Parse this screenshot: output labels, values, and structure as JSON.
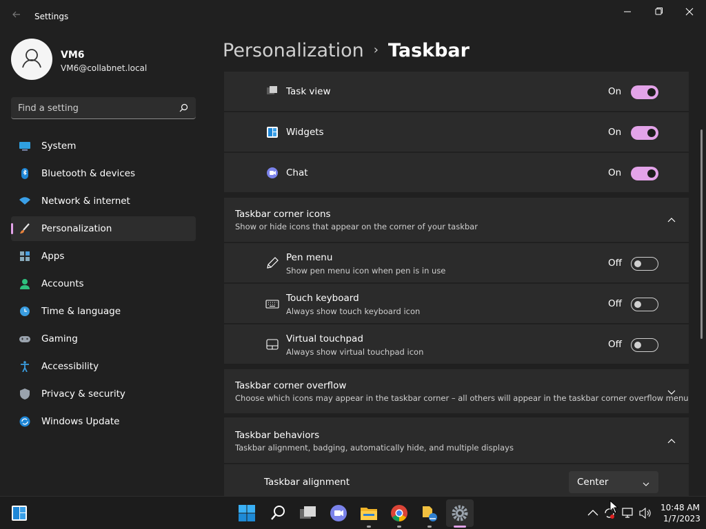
{
  "app": {
    "title": "Settings"
  },
  "user": {
    "name": "VM6",
    "email": "VM6@collabnet.local"
  },
  "search": {
    "placeholder": "Find a setting"
  },
  "sidebar": {
    "items": [
      {
        "label": "System",
        "icon": "monitor-icon"
      },
      {
        "label": "Bluetooth & devices",
        "icon": "bluetooth-icon"
      },
      {
        "label": "Network & internet",
        "icon": "wifi-icon"
      },
      {
        "label": "Personalization",
        "icon": "brush-icon",
        "active": true
      },
      {
        "label": "Apps",
        "icon": "apps-icon"
      },
      {
        "label": "Accounts",
        "icon": "person-icon"
      },
      {
        "label": "Time & language",
        "icon": "clock-globe-icon"
      },
      {
        "label": "Gaming",
        "icon": "gamepad-icon"
      },
      {
        "label": "Accessibility",
        "icon": "accessibility-icon"
      },
      {
        "label": "Privacy & security",
        "icon": "shield-icon"
      },
      {
        "label": "Windows Update",
        "icon": "update-icon"
      }
    ]
  },
  "breadcrumb": {
    "parent": "Personalization",
    "separator": "›",
    "current": "Taskbar"
  },
  "taskbar_items": [
    {
      "label": "Task view",
      "state": "On",
      "on": true
    },
    {
      "label": "Widgets",
      "state": "On",
      "on": true
    },
    {
      "label": "Chat",
      "state": "On",
      "on": true
    }
  ],
  "corner_icons": {
    "title": "Taskbar corner icons",
    "desc": "Show or hide icons that appear on the corner of your taskbar",
    "items": [
      {
        "label": "Pen menu",
        "desc": "Show pen menu icon when pen is in use",
        "state": "Off",
        "on": false
      },
      {
        "label": "Touch keyboard",
        "desc": "Always show touch keyboard icon",
        "state": "Off",
        "on": false
      },
      {
        "label": "Virtual touchpad",
        "desc": "Always show virtual touchpad icon",
        "state": "Off",
        "on": false
      }
    ]
  },
  "corner_overflow": {
    "title": "Taskbar corner overflow",
    "desc": "Choose which icons may appear in the taskbar corner – all others will appear in the taskbar corner overflow menu"
  },
  "behaviors": {
    "title": "Taskbar behaviors",
    "desc": "Taskbar alignment, badging, automatically hide, and multiple displays",
    "alignment_label": "Taskbar alignment",
    "alignment_value": "Center"
  },
  "clock": {
    "time": "10:48 AM",
    "date": "1/7/2023"
  },
  "colors": {
    "accent": "#e3a3e9",
    "background": "#202020",
    "card": "#2b2b2b"
  }
}
